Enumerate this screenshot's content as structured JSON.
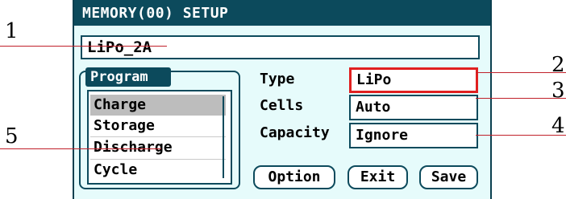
{
  "window": {
    "title": "MEMORY(00) SETUP"
  },
  "name_field": {
    "value": "LiPo_2A"
  },
  "program": {
    "label": "Program",
    "items": [
      {
        "label": "Charge",
        "selected": true
      },
      {
        "label": "Storage",
        "selected": false
      },
      {
        "label": "Discharge",
        "selected": false
      },
      {
        "label": "Cycle",
        "selected": false
      }
    ]
  },
  "params": {
    "type": {
      "label": "Type",
      "value": "LiPo"
    },
    "cells": {
      "label": "Cells",
      "value": "Auto"
    },
    "capacity": {
      "label": "Capacity",
      "value": "Ignore"
    }
  },
  "buttons": {
    "option": "Option",
    "exit": "Exit",
    "save": "Save"
  },
  "callouts": [
    "1",
    "2",
    "3",
    "4",
    "5"
  ],
  "colors": {
    "title_bar": "#0c4a5c",
    "screen_bg": "#e6fbfb",
    "highlight_border": "#e02020",
    "leader_line": "#c0202a"
  }
}
